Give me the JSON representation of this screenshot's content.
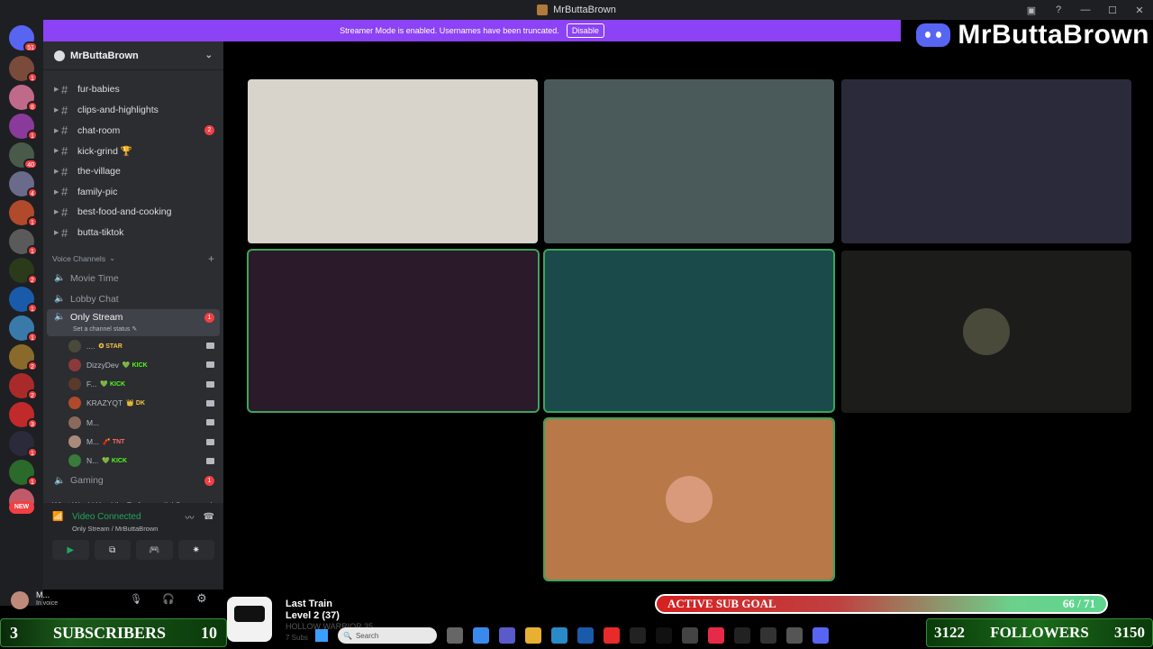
{
  "window": {
    "title": "MrButtaBrown",
    "controls": [
      "▣",
      "?",
      "—",
      "☐",
      "✕"
    ]
  },
  "banner": {
    "text": "Streamer Mode is enabled. Usernames have been truncated.",
    "button": "Disable"
  },
  "brand": {
    "text": "MrButtaBrown"
  },
  "rail": {
    "home_badge": "51",
    "servers": [
      {
        "color": "#7a4a3a",
        "badge": "1"
      },
      {
        "color": "#c06a8a",
        "badge": "8"
      },
      {
        "color": "#8a3a9a",
        "badge": "1"
      },
      {
        "color": "#4a5a4a",
        "badge": "40"
      },
      {
        "color": "#6a6a8a",
        "badge": "4"
      },
      {
        "color": "#b04a2a",
        "badge": "1"
      },
      {
        "color": "#5a5a5a",
        "badge": "1"
      },
      {
        "color": "#2a3a1a",
        "badge": "2"
      },
      {
        "color": "#1a5aaa",
        "badge": "1"
      },
      {
        "color": "#3a7aaa",
        "badge": "1"
      },
      {
        "color": "#8a6a2a",
        "badge": "2"
      },
      {
        "color": "#aa2a2a",
        "badge": "2"
      },
      {
        "color": "#c02a2a",
        "badge": "3"
      },
      {
        "color": "#2a2a3a",
        "badge": "1"
      },
      {
        "color": "#2a6a2a",
        "badge": "1"
      },
      {
        "color": "#c05a6a",
        "badge": ""
      }
    ],
    "new_label": "NEW"
  },
  "sidebar": {
    "server_name": "MrButtaBrown",
    "text_channels": [
      {
        "name": "fur-babies",
        "badge": ""
      },
      {
        "name": "clips-and-highlights",
        "badge": ""
      },
      {
        "name": "chat-room",
        "badge": "2"
      },
      {
        "name": "kick-grind 🏆",
        "badge": ""
      },
      {
        "name": "the-village",
        "badge": ""
      },
      {
        "name": "family-pic",
        "badge": ""
      },
      {
        "name": "best-food-and-cooking",
        "badge": ""
      },
      {
        "name": "butta-tiktok",
        "badge": ""
      }
    ],
    "voice_category": "Voice Channels",
    "voice_channels": {
      "movie": "Movie Time",
      "lobby": "Lobby Chat",
      "active": "Only Stream",
      "active_badge": "1",
      "active_status": "Set a channel status ✎",
      "gaming": "Gaming",
      "gaming_badge": "1"
    },
    "voice_users": [
      {
        "name": "....",
        "tag": "✪ STAR",
        "tag_color": "#f5c542",
        "avatar": "#4a4a3a"
      },
      {
        "name": "DizzyDev",
        "tag": "💚 KICK",
        "tag_color": "#53fc18",
        "avatar": "#8a3a3a"
      },
      {
        "name": "F...",
        "tag": "💚 KICK",
        "tag_color": "#53fc18",
        "avatar": "#5a3a2a"
      },
      {
        "name": "KRAZYQT",
        "tag": "👑 DK",
        "tag_color": "#f5c542",
        "avatar": "#b04a2a"
      },
      {
        "name": "M...",
        "tag": "",
        "tag_color": "#ffffff",
        "avatar": "#8a6a5a"
      },
      {
        "name": "M...",
        "tag": "🧨 TNT",
        "tag_color": "#ff6a6a",
        "avatar": "#aa8a7a"
      },
      {
        "name": "N...",
        "tag": "💚 KICK",
        "tag_color": "#53fc18",
        "avatar": "#3a7a3a"
      }
    ],
    "next_category": "What Would You Like To Accomplish?"
  },
  "voice_panel": {
    "status": "Video Connected",
    "sub": "Only Stream / MrButtaBrown",
    "actions": [
      "▶",
      "⧉",
      "🎮",
      "✷"
    ]
  },
  "user": {
    "name": "M...",
    "status": "In voice"
  },
  "overlays": {
    "subs_current": "3",
    "subs_label": "SUBSCRIBERS",
    "subs_goal": "10",
    "goal_label": "ACTIVE SUB GOAL",
    "goal_value": "66 / 71",
    "goal_fraction": 0.93,
    "followers_current": "3122",
    "followers_label": "FOLLOWERS",
    "followers_goal": "3150",
    "train_title": "Last Train",
    "train_level": "Level 2  (37)",
    "train_ghost": "HOLLOW WARRIOR 35",
    "train_ghost2": "7 Subs"
  },
  "taskbar": {
    "search": "Search"
  },
  "tiles": {
    "t1": "#d8d4cc",
    "t2": "#4a5a5a",
    "t3": "#2a2a3a",
    "t4": "#2a1a2a",
    "t5": "#1a4a4a",
    "t6": "#1c1c1a",
    "t7": "#b87848"
  }
}
